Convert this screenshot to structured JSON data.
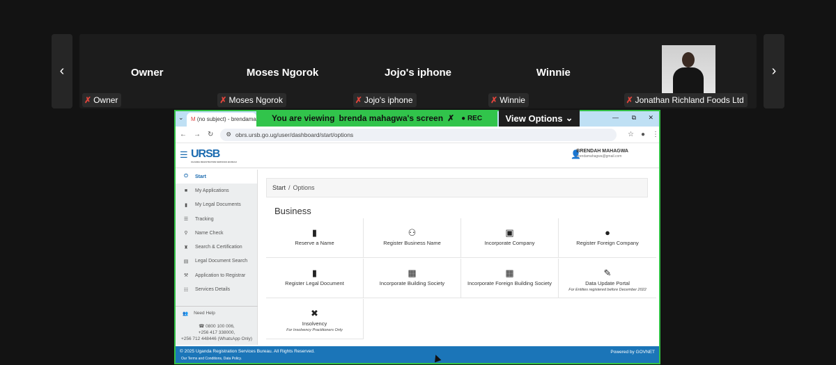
{
  "participants": [
    {
      "name": "Owner",
      "tag": "Owner"
    },
    {
      "name": "Moses Ngorok",
      "tag": "Moses Ngorok"
    },
    {
      "name": "Jojo's iphone",
      "tag": "Jojo's iphone"
    },
    {
      "name": "Winnie",
      "tag": "Winnie"
    },
    {
      "name": "",
      "tag": "Jonathan Richland Foods Ltd"
    }
  ],
  "nav": {
    "prev": "‹",
    "next": "›"
  },
  "share_bar": {
    "viewing": "You are viewing",
    "presenter": "brenda mahagwa's screen",
    "rec": "REC",
    "view_options": "View Options"
  },
  "browser": {
    "tab_title": "(no subject) - brendamaha",
    "url": "obrs.ursb.go.ug/user/dashboard/start/options",
    "controls": {
      "min": "—",
      "max": "⧉",
      "close": "✕"
    }
  },
  "app": {
    "logo": "URSB",
    "logo_sub": "UGANDA REGISTRATION SERVICES BUREAU",
    "user_name": "BRENDAH MAHAGWA",
    "user_email": "brendamahagwa@gmail.com",
    "sidebar": [
      {
        "icon": "⏻",
        "label": "Start",
        "active": true
      },
      {
        "icon": "■",
        "label": "My Applications"
      },
      {
        "icon": "▮",
        "label": "My Legal Documents"
      },
      {
        "icon": "☰",
        "label": "Tracking"
      },
      {
        "icon": "⚲",
        "label": "Name Check"
      },
      {
        "icon": "♜",
        "label": "Search & Certification"
      },
      {
        "icon": "▤",
        "label": "Legal Document Search"
      },
      {
        "icon": "⚒",
        "label": "Application to Registrar"
      },
      {
        "icon": "☷",
        "label": "Services Details"
      }
    ],
    "help": {
      "title": "Need Help",
      "phone1": "0800 100 006,",
      "phone2": "+256 417 338000,",
      "phone3": "+256 712 448446 (WhatsApp Only)"
    },
    "breadcrumb": {
      "first": "Start",
      "sep": "/",
      "current": "Options"
    },
    "section_title": "Business",
    "options": [
      {
        "icon": "📕",
        "label": "Reserve a Name",
        "sub": ""
      },
      {
        "icon": "🤝",
        "label": "Register Business Name",
        "sub": ""
      },
      {
        "icon": "💼",
        "label": "Incorporate Company",
        "sub": ""
      },
      {
        "icon": "🌐",
        "label": "Register Foreign Company",
        "sub": ""
      },
      {
        "icon": "📄",
        "label": "Register Legal Document",
        "sub": ""
      },
      {
        "icon": "🏢",
        "label": "Incorporate Building Society",
        "sub": ""
      },
      {
        "icon": "🏢",
        "label": "Incorporate Foreign Building Society",
        "sub": ""
      },
      {
        "icon": "✎",
        "label": "Data Update Portal",
        "sub": "For Entities registered before December 2022"
      },
      {
        "icon": "✖",
        "label": "Insolvency",
        "sub": "For Insolvency Practitioners Only"
      }
    ],
    "footer": {
      "copyright": "© 2025 Uganda Registration Services Bureau. All Rights Reserved.",
      "links": "Our Terms and Conditions, Data Policy.",
      "powered": "Powered by GOVNET"
    }
  },
  "colors": {
    "accent": "#1b75b8",
    "share_green": "#33c146",
    "muted_mic": "#e0453c"
  }
}
